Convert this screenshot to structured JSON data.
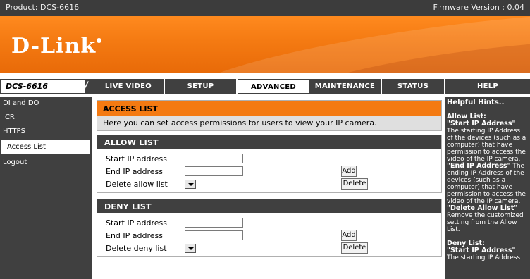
{
  "topbar": {
    "product": "Product: DCS-6616",
    "firmware": "Firmware Version : 0.04"
  },
  "brand": {
    "logo_text": "D-Link"
  },
  "nav": {
    "model": "DCS-6616",
    "model_slashes": "///",
    "tabs": [
      {
        "label": "LIVE VIDEO"
      },
      {
        "label": "SETUP"
      },
      {
        "label": "ADVANCED",
        "active": true
      },
      {
        "label": "MAINTENANCE"
      },
      {
        "label": "STATUS"
      },
      {
        "label": "HELP"
      }
    ]
  },
  "sidebar": {
    "items": [
      {
        "label": "DI and DO"
      },
      {
        "label": "ICR"
      },
      {
        "label": "HTTPS"
      },
      {
        "label": "Access List",
        "active": true
      },
      {
        "label": "Logout"
      }
    ]
  },
  "access": {
    "title": "ACCESS LIST",
    "description": "Here you can set access permissions for users to view your IP camera."
  },
  "allow": {
    "title": "ALLOW LIST",
    "start_label": "Start IP address",
    "end_label": "End IP address",
    "delete_label": "Delete allow list",
    "start_value": "",
    "end_value": "",
    "add_button": "Add",
    "delete_button": "Delete"
  },
  "deny": {
    "title": "DENY LIST",
    "start_label": "Start IP address",
    "end_label": "End IP address",
    "delete_label": "Delete deny list",
    "start_value": "",
    "end_value": "",
    "add_button": "Add",
    "delete_button": "Delete"
  },
  "hints": {
    "title": "Helpful Hints..",
    "allow_heading": "Allow List:",
    "allow_start_term": "\"Start IP Address\"",
    "allow_start_text": "The starting IP Address of the devices (such as a computer) that have permission to access the video of the IP camera.",
    "allow_end_term": "\"End IP Address\"",
    "allow_end_text": "The ending IP Address of the devices (such as a computer) that have permission to access the video of the IP camera.",
    "allow_delete_term": "\"Delete Allow List\"",
    "allow_delete_text": "Remove the customized setting from the Allow List.",
    "deny_heading": "Deny List:",
    "deny_start_term": "\"Start IP Address\"",
    "deny_start_text": "The starting IP Address"
  }
}
